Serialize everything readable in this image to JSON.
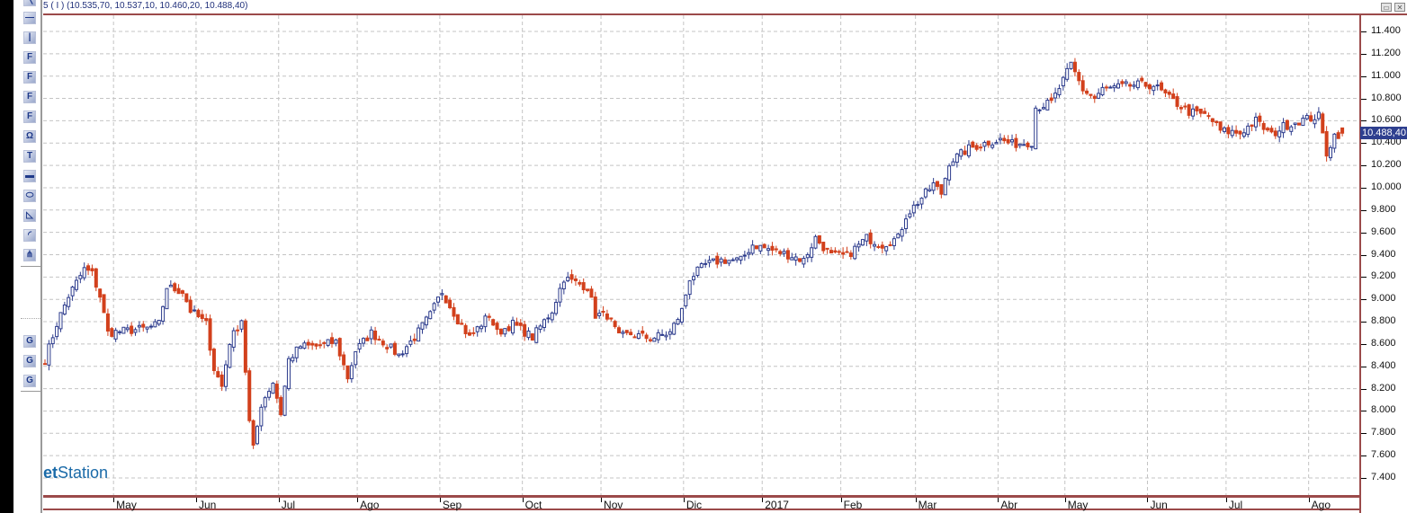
{
  "header": {
    "ohlc_text": "5 ( I ) (10.535,70, 10.537,10, 10.460,20, 10.488,40)"
  },
  "window_buttons": {
    "restore": "▭",
    "close": "✕"
  },
  "toolbar": {
    "tools": [
      {
        "name": "trendline-tool-icon",
        "glyph": "╲"
      },
      {
        "name": "horizontal-line-tool-icon",
        "glyph": "—"
      },
      {
        "name": "vertical-line-tool-icon",
        "glyph": "|"
      },
      {
        "name": "fibonacci-fan-tool-icon",
        "glyph": "F"
      },
      {
        "name": "fibonacci-arcs-tool-icon",
        "glyph": "F"
      },
      {
        "name": "fibonacci-retracement-tool-icon",
        "glyph": "F"
      },
      {
        "name": "fibonacci-time-tool-icon",
        "glyph": "F"
      },
      {
        "name": "symbol-tool-icon",
        "glyph": "Ω"
      },
      {
        "name": "text-tool-icon",
        "glyph": "T"
      },
      {
        "name": "rectangle-tool-icon",
        "glyph": "▬"
      },
      {
        "name": "ellipse-tool-icon",
        "glyph": "⬭"
      },
      {
        "name": "triangle-tool-icon",
        "glyph": "◺"
      },
      {
        "name": "arc-tool-icon",
        "glyph": "◜"
      },
      {
        "name": "andrews-pitchfork-tool-icon",
        "glyph": "⋔"
      }
    ],
    "gann_tools": [
      {
        "name": "gann-fan-tool-icon",
        "glyph": "G"
      },
      {
        "name": "gann-grid-tool-icon",
        "glyph": "G"
      },
      {
        "name": "gann-line-tool-icon",
        "glyph": "G"
      }
    ]
  },
  "watermark": {
    "bold": "et",
    "rest": "Station"
  },
  "last_price_label": "10.488,40",
  "colors": {
    "up": "#2b3a8c",
    "down": "#d2401c",
    "grid": "#c4c4c4",
    "axis": "#9b4a4a"
  },
  "chart_data": {
    "type": "candlestick",
    "y_ticks": [
      "11.400",
      "11.200",
      "11.000",
      "10.800",
      "10.600",
      "10.400",
      "10.200",
      "10.000",
      "9.800",
      "9.600",
      "9.400",
      "9.200",
      "9.000",
      "8.800",
      "8.600",
      "8.400",
      "8.200",
      "8.000",
      "7.800",
      "7.600",
      "7.400"
    ],
    "ylim": [
      7.4,
      11.4
    ],
    "x_ticks": [
      {
        "label": "May",
        "day": 14
      },
      {
        "label": "Jun",
        "day": 35
      },
      {
        "label": "Jul",
        "day": 56
      },
      {
        "label": "Ago",
        "day": 76
      },
      {
        "label": "Sep",
        "day": 97
      },
      {
        "label": "Oct",
        "day": 118
      },
      {
        "label": "Nov",
        "day": 138
      },
      {
        "label": "Dic",
        "day": 159
      },
      {
        "label": "2017",
        "day": 179
      },
      {
        "label": "Feb",
        "day": 199
      },
      {
        "label": "Mar",
        "day": 218
      },
      {
        "label": "Abr",
        "day": 239
      },
      {
        "label": "May",
        "day": 256
      },
      {
        "label": "Jun",
        "day": 277
      },
      {
        "label": "Jul",
        "day": 297
      },
      {
        "label": "Ago",
        "day": 318
      }
    ],
    "total_days": 331,
    "close_anchors": [
      [
        0,
        8.46
      ],
      [
        3,
        8.78
      ],
      [
        6,
        9.03
      ],
      [
        10,
        9.27
      ],
      [
        12,
        9.23
      ],
      [
        14,
        9.03
      ],
      [
        16,
        8.7
      ],
      [
        21,
        8.72
      ],
      [
        26,
        8.74
      ],
      [
        29,
        8.78
      ],
      [
        31,
        9.11
      ],
      [
        35,
        9.07
      ],
      [
        37,
        8.9
      ],
      [
        41,
        8.78
      ],
      [
        43,
        8.38
      ],
      [
        45,
        8.22
      ],
      [
        47,
        8.62
      ],
      [
        50,
        8.82
      ],
      [
        52,
        7.9
      ],
      [
        53,
        7.66
      ],
      [
        55,
        8.06
      ],
      [
        58,
        8.26
      ],
      [
        60,
        7.98
      ],
      [
        62,
        8.46
      ],
      [
        65,
        8.58
      ],
      [
        69,
        8.58
      ],
      [
        74,
        8.62
      ],
      [
        77,
        8.3
      ],
      [
        79,
        8.54
      ],
      [
        83,
        8.7
      ],
      [
        86,
        8.62
      ],
      [
        90,
        8.5
      ],
      [
        94,
        8.66
      ],
      [
        98,
        8.86
      ],
      [
        101,
        9.07
      ],
      [
        105,
        8.82
      ],
      [
        108,
        8.66
      ],
      [
        113,
        8.86
      ],
      [
        115,
        8.7
      ],
      [
        119,
        8.78
      ],
      [
        124,
        8.66
      ],
      [
        129,
        8.9
      ],
      [
        132,
        9.19
      ],
      [
        135,
        9.15
      ],
      [
        138,
        9.11
      ],
      [
        140,
        8.86
      ],
      [
        143,
        8.86
      ],
      [
        146,
        8.66
      ],
      [
        149,
        8.69
      ],
      [
        154,
        8.65
      ],
      [
        159,
        8.7
      ],
      [
        162,
        8.9
      ],
      [
        164,
        9.19
      ],
      [
        168,
        9.31
      ],
      [
        172,
        9.35
      ],
      [
        177,
        9.35
      ],
      [
        180,
        9.49
      ],
      [
        186,
        9.43
      ],
      [
        190,
        9.39
      ],
      [
        193,
        9.35
      ],
      [
        196,
        9.55
      ],
      [
        200,
        9.39
      ],
      [
        204,
        9.39
      ],
      [
        209,
        9.55
      ],
      [
        213,
        9.49
      ],
      [
        217,
        9.55
      ],
      [
        219,
        9.75
      ],
      [
        222,
        9.87
      ],
      [
        226,
        10.03
      ],
      [
        228,
        9.95
      ],
      [
        230,
        10.23
      ],
      [
        235,
        10.35
      ],
      [
        240,
        10.41
      ],
      [
        243,
        10.43
      ],
      [
        246,
        10.39
      ],
      [
        251,
        10.41
      ],
      [
        252,
        10.72
      ],
      [
        256,
        10.76
      ],
      [
        259,
        10.96
      ],
      [
        261,
        11.1
      ],
      [
        264,
        10.88
      ],
      [
        267,
        10.8
      ],
      [
        269,
        10.88
      ],
      [
        273,
        10.9
      ],
      [
        277,
        10.92
      ],
      [
        282,
        10.92
      ],
      [
        286,
        10.8
      ],
      [
        291,
        10.68
      ],
      [
        296,
        10.64
      ],
      [
        299,
        10.51
      ],
      [
        304,
        10.49
      ],
      [
        308,
        10.6
      ],
      [
        312,
        10.47
      ],
      [
        315,
        10.55
      ],
      [
        319,
        10.6
      ],
      [
        324,
        10.64
      ],
      [
        326,
        10.31
      ],
      [
        328,
        10.47
      ],
      [
        330,
        10.4884
      ]
    ],
    "last_candle": {
      "open": 10.5357,
      "high": 10.5371,
      "low": 10.4602,
      "close": 10.4884
    }
  }
}
